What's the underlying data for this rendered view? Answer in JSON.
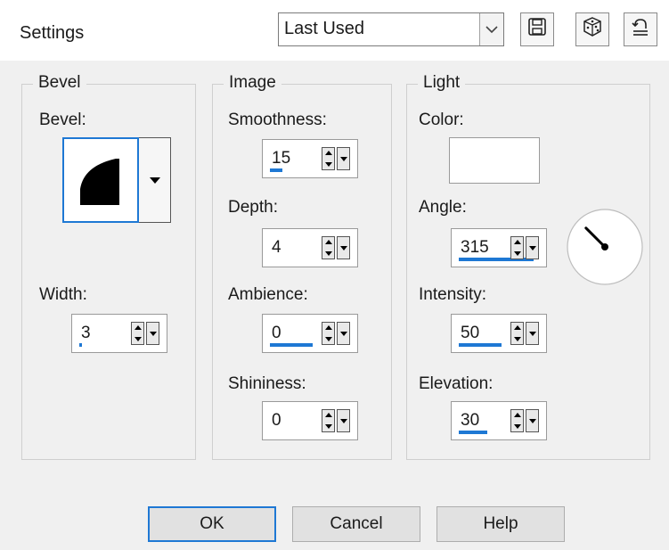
{
  "header": {
    "settings_label": "Settings",
    "preset": {
      "selected": "Last Used"
    },
    "icons": [
      "save-preset-icon",
      "randomize-dice-icon",
      "reset-arrow-icon"
    ]
  },
  "bevel_group": {
    "title": "Bevel",
    "bevel_label": "Bevel:",
    "width_label": "Width:",
    "width_value": "3",
    "width_level": 0.03
  },
  "image_group": {
    "title": "Image",
    "smoothness_label": "Smoothness:",
    "smoothness_value": "15",
    "smoothness_level": 0.15,
    "depth_label": "Depth:",
    "depth_value": "4",
    "ambience_label": "Ambience:",
    "ambience_value": "0",
    "ambience_level": 0.5,
    "shininess_label": "Shininess:",
    "shininess_value": "0"
  },
  "light_group": {
    "title": "Light",
    "color_label": "Color:",
    "color_value": "#ffffff",
    "angle_label": "Angle:",
    "angle_value": "315",
    "angle_level": 0.875,
    "intensity_label": "Intensity:",
    "intensity_value": "50",
    "intensity_level": 0.5,
    "elevation_label": "Elevation:",
    "elevation_value": "30",
    "elevation_level": 0.33
  },
  "buttons": {
    "ok": "OK",
    "cancel": "Cancel",
    "help": "Help"
  },
  "colors": {
    "accent": "#1e78d4",
    "panel_bg": "#f0f0f0"
  }
}
